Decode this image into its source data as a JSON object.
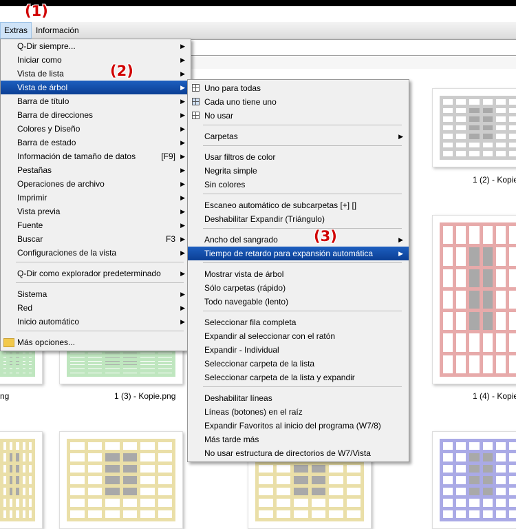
{
  "annotations": {
    "a1": "(1)",
    "a2": "(2)",
    "a3": "(3)"
  },
  "menubar": {
    "extras": "Extras",
    "informacion": "Información"
  },
  "extras_menu": {
    "items": [
      {
        "label": "Q-Dir siempre...",
        "shortcut": "",
        "submenu": true
      },
      {
        "label": "Iniciar como",
        "shortcut": "",
        "submenu": true
      },
      {
        "label": "Vista de lista",
        "shortcut": "",
        "submenu": true
      },
      {
        "label": "Vista de árbol",
        "shortcut": "",
        "submenu": true
      },
      {
        "label": "Barra de título",
        "shortcut": "",
        "submenu": true
      },
      {
        "label": "Barra de direcciones",
        "shortcut": "",
        "submenu": true
      },
      {
        "label": "Colores y Diseño",
        "shortcut": "",
        "submenu": true
      },
      {
        "label": "Barra de estado",
        "shortcut": "",
        "submenu": true
      },
      {
        "label": "Información de tamaño de datos",
        "shortcut": "[F9]",
        "submenu": true
      },
      {
        "label": "Pestañas",
        "shortcut": "",
        "submenu": true
      },
      {
        "label": "Operaciones de archivo",
        "shortcut": "",
        "submenu": true
      },
      {
        "label": "Imprimir",
        "shortcut": "",
        "submenu": true
      },
      {
        "label": "Vista previa",
        "shortcut": "",
        "submenu": true
      },
      {
        "label": "Fuente",
        "shortcut": "",
        "submenu": true
      },
      {
        "label": "Buscar",
        "shortcut": "F3",
        "submenu": true
      },
      {
        "label": "Configuraciones de la vista",
        "shortcut": "",
        "submenu": true
      },
      {
        "label": "Q-Dir como explorador predeterminado",
        "shortcut": "",
        "submenu": true
      },
      {
        "label": "Sistema",
        "shortcut": "",
        "submenu": true
      },
      {
        "label": "Red",
        "shortcut": "",
        "submenu": true
      },
      {
        "label": "Inicio automático",
        "shortcut": "",
        "submenu": true
      },
      {
        "label": "Más opciones...",
        "shortcut": "",
        "submenu": false
      }
    ]
  },
  "arbol_menu": {
    "items": [
      {
        "label": "Uno para todas"
      },
      {
        "label": "Cada uno tiene uno"
      },
      {
        "label": "No usar"
      },
      {
        "label": "Carpetas"
      },
      {
        "label": "Usar filtros de color"
      },
      {
        "label": "Negrita simple"
      },
      {
        "label": "Sin colores"
      },
      {
        "label": "Escaneo automático de subcarpetas [+] []"
      },
      {
        "label": "Deshabilitar Expandir (Triángulo)"
      },
      {
        "label": "Ancho del sangrado"
      },
      {
        "label": "Tiempo de retardo para expansión automática"
      },
      {
        "label": "Mostrar vista de árbol"
      },
      {
        "label": "Sólo carpetas (rápido)"
      },
      {
        "label": "Todo navegable (lento)"
      },
      {
        "label": "Seleccionar fila completa"
      },
      {
        "label": "Expandir al seleccionar con el ratón"
      },
      {
        "label": "Expandir - Individual"
      },
      {
        "label": "Seleccionar carpeta de la lista"
      },
      {
        "label": "Seleccionar carpeta de la lista y expandir"
      },
      {
        "label": "Deshabilitar líneas"
      },
      {
        "label": "Líneas (botones) en el raíz"
      },
      {
        "label": "Expandir Favoritos al inicio del programa (W7/8)"
      },
      {
        "label": "Más tarde más"
      },
      {
        "label": "No usar estructura de directorios de W7/Vista"
      }
    ]
  },
  "files": {
    "captions": [
      "1 (2) - Kopie",
      "ng",
      "1 (3) - Kopie.png",
      "1 (4) - Kopie"
    ],
    "colors": {
      "gray": "#cccccc",
      "red": "#e7aaaa",
      "green": "#bfe6bf",
      "yellow": "#eadfa8",
      "blue": "#aaaae6"
    }
  }
}
